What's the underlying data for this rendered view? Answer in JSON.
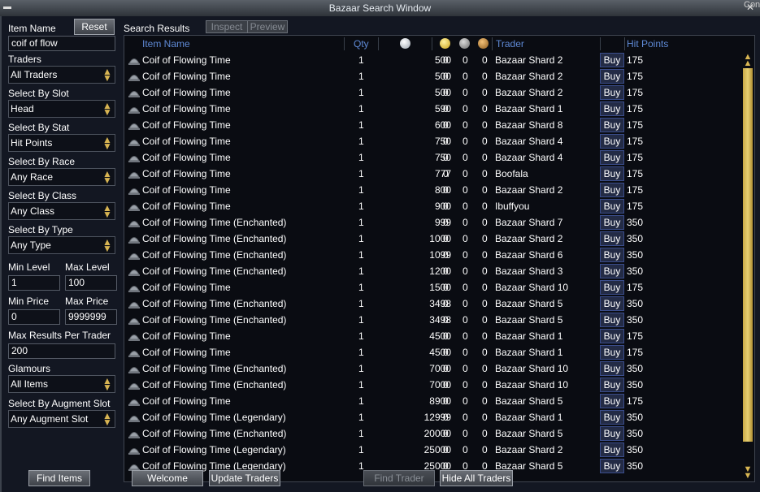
{
  "window": {
    "title": "Bazaar Search Window",
    "bg_right_text": "Con"
  },
  "left_panel": {
    "item_name_label": "Item Name",
    "reset_label": "Reset",
    "item_name_value": "coif of flow",
    "traders_label": "Traders",
    "traders_value": "All Traders",
    "slot_label": "Select By Slot",
    "slot_value": "Head",
    "stat_label": "Select By Stat",
    "stat_value": "Hit Points",
    "race_label": "Select By Race",
    "race_value": "Any Race",
    "class_label": "Select By Class",
    "class_value": "Any Class",
    "type_label": "Select By Type",
    "type_value": "Any Type",
    "min_level_label": "Min Level",
    "max_level_label": "Max Level",
    "min_level_value": "1",
    "max_level_value": "100",
    "min_price_label": "Min Price",
    "max_price_label": "Max Price",
    "min_price_value": "0",
    "max_price_value": "9999999",
    "max_results_label": "Max Results Per Trader",
    "max_results_value": "200",
    "glamours_label": "Glamours",
    "glamours_value": "All Items",
    "augment_label": "Select By Augment Slot",
    "augment_value": "Any Augment Slot"
  },
  "results_header": {
    "title": "Search Results",
    "inspect_label": "Inspect",
    "preview_label": "Preview"
  },
  "columns": {
    "item_name": "Item Name",
    "qty": "Qty",
    "trader": "Trader",
    "hit_points": "Hit Points"
  },
  "buy_label": "Buy",
  "rows": [
    {
      "name": "Coif of Flowing Time",
      "qty": "1",
      "price": "500",
      "g": "0",
      "s": "0",
      "c": "0",
      "trader": "Bazaar Shard 2",
      "hp": "175"
    },
    {
      "name": "Coif of Flowing Time",
      "qty": "1",
      "price": "500",
      "g": "0",
      "s": "0",
      "c": "0",
      "trader": "Bazaar Shard 2",
      "hp": "175"
    },
    {
      "name": "Coif of Flowing Time",
      "qty": "1",
      "price": "500",
      "g": "0",
      "s": "0",
      "c": "0",
      "trader": "Bazaar Shard 2",
      "hp": "175"
    },
    {
      "name": "Coif of Flowing Time",
      "qty": "1",
      "price": "590",
      "g": "0",
      "s": "0",
      "c": "0",
      "trader": "Bazaar Shard 1",
      "hp": "175"
    },
    {
      "name": "Coif of Flowing Time",
      "qty": "1",
      "price": "600",
      "g": "0",
      "s": "0",
      "c": "0",
      "trader": "Bazaar Shard 8",
      "hp": "175"
    },
    {
      "name": "Coif of Flowing Time",
      "qty": "1",
      "price": "750",
      "g": "0",
      "s": "0",
      "c": "0",
      "trader": "Bazaar Shard 4",
      "hp": "175"
    },
    {
      "name": "Coif of Flowing Time",
      "qty": "1",
      "price": "750",
      "g": "0",
      "s": "0",
      "c": "0",
      "trader": "Bazaar Shard 4",
      "hp": "175"
    },
    {
      "name": "Coif of Flowing Time",
      "qty": "1",
      "price": "777",
      "g": "0",
      "s": "0",
      "c": "0",
      "trader": "Boofala",
      "hp": "175"
    },
    {
      "name": "Coif of Flowing Time",
      "qty": "1",
      "price": "800",
      "g": "0",
      "s": "0",
      "c": "0",
      "trader": "Bazaar Shard 2",
      "hp": "175"
    },
    {
      "name": "Coif of Flowing Time",
      "qty": "1",
      "price": "900",
      "g": "0",
      "s": "0",
      "c": "0",
      "trader": "Ibuffyou",
      "hp": "175"
    },
    {
      "name": "Coif of Flowing Time (Enchanted)",
      "qty": "1",
      "price": "999",
      "g": "0",
      "s": "0",
      "c": "0",
      "trader": "Bazaar Shard 7",
      "hp": "350"
    },
    {
      "name": "Coif of Flowing Time (Enchanted)",
      "qty": "1",
      "price": "1000",
      "g": "0",
      "s": "0",
      "c": "0",
      "trader": "Bazaar Shard 2",
      "hp": "350"
    },
    {
      "name": "Coif of Flowing Time (Enchanted)",
      "qty": "1",
      "price": "1099",
      "g": "0",
      "s": "0",
      "c": "0",
      "trader": "Bazaar Shard 6",
      "hp": "350"
    },
    {
      "name": "Coif of Flowing Time (Enchanted)",
      "qty": "1",
      "price": "1200",
      "g": "0",
      "s": "0",
      "c": "0",
      "trader": "Bazaar Shard 3",
      "hp": "350"
    },
    {
      "name": "Coif of Flowing Time",
      "qty": "1",
      "price": "1500",
      "g": "0",
      "s": "0",
      "c": "0",
      "trader": "Bazaar Shard 10",
      "hp": "175"
    },
    {
      "name": "Coif of Flowing Time (Enchanted)",
      "qty": "1",
      "price": "3498",
      "g": "0",
      "s": "0",
      "c": "0",
      "trader": "Bazaar Shard 5",
      "hp": "350"
    },
    {
      "name": "Coif of Flowing Time (Enchanted)",
      "qty": "1",
      "price": "3498",
      "g": "0",
      "s": "0",
      "c": "0",
      "trader": "Bazaar Shard 5",
      "hp": "350"
    },
    {
      "name": "Coif of Flowing Time",
      "qty": "1",
      "price": "4500",
      "g": "0",
      "s": "0",
      "c": "0",
      "trader": "Bazaar Shard 1",
      "hp": "175"
    },
    {
      "name": "Coif of Flowing Time",
      "qty": "1",
      "price": "4500",
      "g": "0",
      "s": "0",
      "c": "0",
      "trader": "Bazaar Shard 1",
      "hp": "175"
    },
    {
      "name": "Coif of Flowing Time (Enchanted)",
      "qty": "1",
      "price": "7000",
      "g": "0",
      "s": "0",
      "c": "0",
      "trader": "Bazaar Shard 10",
      "hp": "350"
    },
    {
      "name": "Coif of Flowing Time (Enchanted)",
      "qty": "1",
      "price": "7000",
      "g": "0",
      "s": "0",
      "c": "0",
      "trader": "Bazaar Shard 10",
      "hp": "350"
    },
    {
      "name": "Coif of Flowing Time",
      "qty": "1",
      "price": "8900",
      "g": "0",
      "s": "0",
      "c": "0",
      "trader": "Bazaar Shard 5",
      "hp": "175"
    },
    {
      "name": "Coif of Flowing Time (Legendary)",
      "qty": "1",
      "price": "12999",
      "g": "0",
      "s": "0",
      "c": "0",
      "trader": "Bazaar Shard 1",
      "hp": "350"
    },
    {
      "name": "Coif of Flowing Time (Enchanted)",
      "qty": "1",
      "price": "20000",
      "g": "0",
      "s": "0",
      "c": "0",
      "trader": "Bazaar Shard 5",
      "hp": "350"
    },
    {
      "name": "Coif of Flowing Time (Legendary)",
      "qty": "1",
      "price": "25000",
      "g": "0",
      "s": "0",
      "c": "0",
      "trader": "Bazaar Shard 2",
      "hp": "350"
    },
    {
      "name": "Coif of Flowing Time (Legendary)",
      "qty": "1",
      "price": "25000",
      "g": "0",
      "s": "0",
      "c": "0",
      "trader": "Bazaar Shard 5",
      "hp": "350"
    }
  ],
  "bottom": {
    "find_items": "Find Items",
    "welcome": "Welcome",
    "update_traders": "Update Traders",
    "find_trader": "Find Trader",
    "hide_all_traders": "Hide All Traders"
  },
  "icons": {
    "platinum": "platinum-coin-icon",
    "gold": "gold-coin-icon",
    "silver": "silver-coin-icon",
    "copper": "copper-coin-icon",
    "item": "helm-icon",
    "dropdown": "dropdown-arrows-icon"
  },
  "colors": {
    "header_text": "#5f8ad6",
    "buy_button": "#232b45",
    "scroll_thumb": "#d4b653",
    "panel_bg": "#131722"
  }
}
